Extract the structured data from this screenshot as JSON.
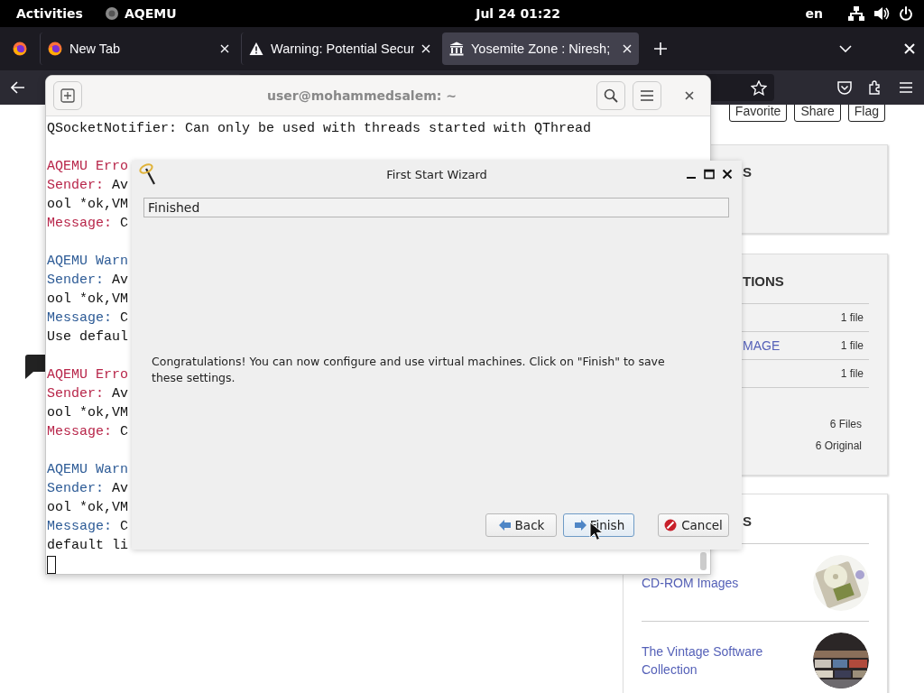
{
  "top_bar": {
    "activities": "Activities",
    "app": "AQEMU",
    "clock": "Jul 24  01:22",
    "language": "en"
  },
  "browser": {
    "tabs": [
      {
        "title": "New Tab",
        "kind": "firefox",
        "selected": false
      },
      {
        "title": "Warning: Potential Secur",
        "kind": "warning",
        "selected": false
      },
      {
        "title": "Yosemite Zone : Niresh;",
        "kind": "museum",
        "selected": true
      }
    ]
  },
  "page": {
    "actions": [
      "Favorite",
      "Share",
      "Flag"
    ],
    "cards": [
      {
        "kind": "plain",
        "heading": "S"
      },
      {
        "kind": "files",
        "heading": "TIONS",
        "rows": [
          {
            "count": "1 file"
          },
          {
            "link": "MAGE",
            "count": "1 file"
          },
          {
            "count": "1 file"
          }
        ],
        "totals": [
          "6 Files",
          "6 Original"
        ]
      },
      {
        "kind": "links",
        "heading": "S",
        "items": [
          {
            "title": "CD-ROM Images",
            "kind": "picture"
          },
          {
            "title": "The Vintage Software Collection",
            "kind": "picture"
          }
        ]
      }
    ]
  },
  "terminal": {
    "title": "user@mohammedsalem: ~",
    "blocks": [
      {
        "lines": [
          {
            "kind": "plain",
            "text": "QSocketNotifier: Can only be used with threads started with QThread"
          }
        ]
      },
      {
        "lines": [
          {
            "kind": "error",
            "text": "AQEMU Erro"
          },
          {
            "kind": "error",
            "label": "Sender:",
            "text": "Av"
          },
          {
            "kind": "plain",
            "text": "ool *ok,VM"
          },
          {
            "kind": "error",
            "label": "Message:",
            "text": "C"
          }
        ]
      },
      {
        "lines": [
          {
            "kind": "warning",
            "text": "AQEMU Warn"
          },
          {
            "kind": "warning",
            "label": "Sender:",
            "text": "Av"
          },
          {
            "kind": "plain",
            "text": "ool *ok,VM"
          },
          {
            "kind": "warning",
            "label": "Message:",
            "text": "C"
          },
          {
            "kind": "plain",
            "text": "Use defaul"
          }
        ]
      },
      {
        "lines": [
          {
            "kind": "error",
            "text": "AQEMU Erro"
          },
          {
            "kind": "error",
            "label": "Sender:",
            "text": "Av"
          },
          {
            "kind": "plain",
            "text": "ool *ok,VM"
          },
          {
            "kind": "error",
            "label": "Message:",
            "text": "C"
          }
        ]
      },
      {
        "lines": [
          {
            "kind": "warning",
            "text": "AQEMU Warn"
          },
          {
            "kind": "warning",
            "label": "Sender:",
            "text": "Av"
          },
          {
            "kind": "plain",
            "text": "ool *ok,VM"
          },
          {
            "kind": "warning",
            "label": "Message:",
            "text": "C"
          },
          {
            "kind": "plain",
            "text": "default li"
          }
        ]
      }
    ]
  },
  "wizard": {
    "title": "First Start Wizard",
    "page_title": "Finished",
    "message": "Congratulations! You can now configure and use virtual machines. Click on \"Finish\" to save these settings.",
    "buttons": [
      {
        "label": "Back",
        "kind": "back",
        "focused": false
      },
      {
        "label": "Finish",
        "kind": "finish",
        "focused": true
      },
      {
        "label": "Cancel",
        "kind": "cancel",
        "focused": false
      }
    ]
  }
}
